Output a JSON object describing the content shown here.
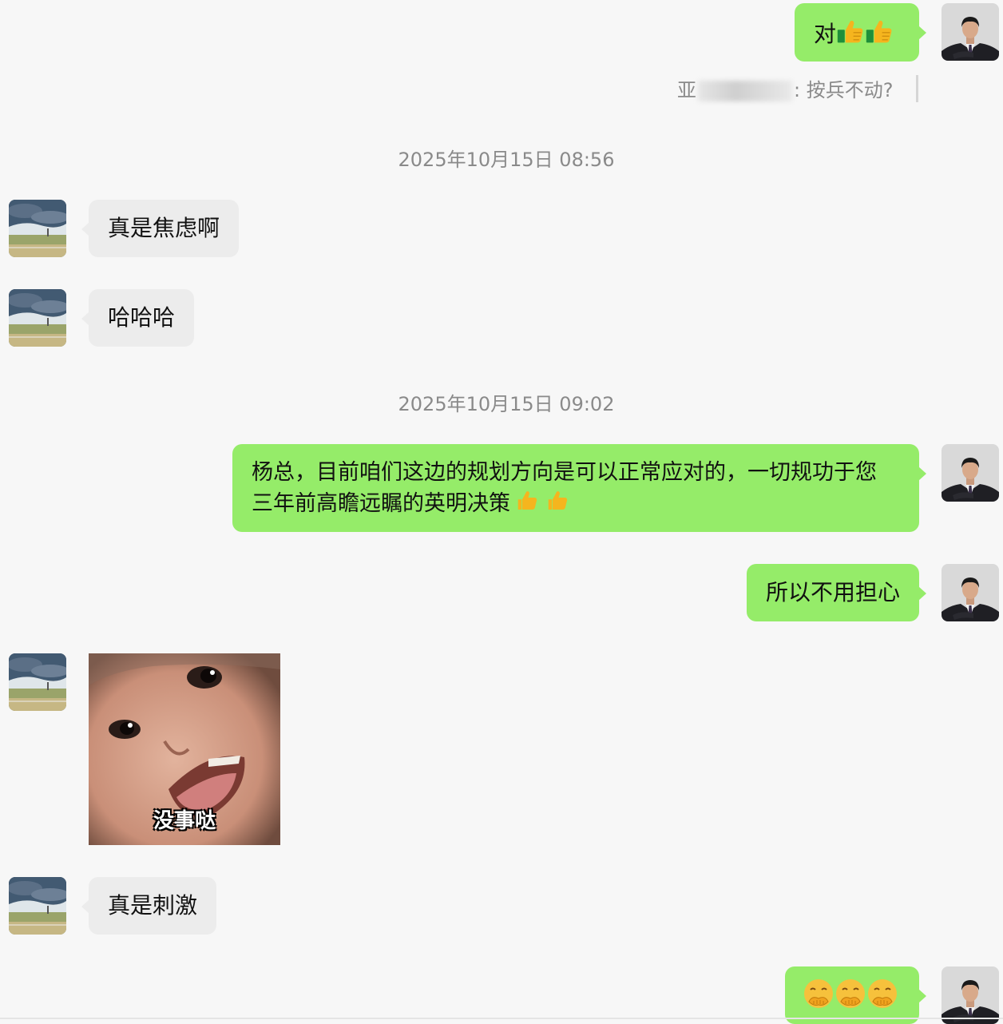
{
  "messages": {
    "m1_text": "对",
    "quote_prefix": "亚",
    "quote_suffix": ": 按兵不动?",
    "timestamp1": "2025年10月15日 08:56",
    "m2_text": "真是焦虑啊",
    "m3_text": "哈哈哈",
    "timestamp2": "2025年10月15日 09:02",
    "m4_line1": "杨总，目前咱们这边的规划方向是可以正常应对的，一切规功于您",
    "m4_line2": "三年前高瞻远瞩的英明决策",
    "m5_text": "所以不用担心",
    "sticker_caption": "没事哒",
    "m6_text": "真是刺激"
  },
  "icons": {
    "thumbs_up": "thumbs-up-emoji",
    "face": "hand-over-mouth-emoji",
    "avatar_self": "man-in-suit-avatar",
    "avatar_other": "landscape-avatar"
  },
  "colors": {
    "outgoing_bubble": "#95ec69",
    "incoming_bubble": "#ececec",
    "background": "#f7f7f7",
    "timestamp_text": "#8a8a8a"
  }
}
